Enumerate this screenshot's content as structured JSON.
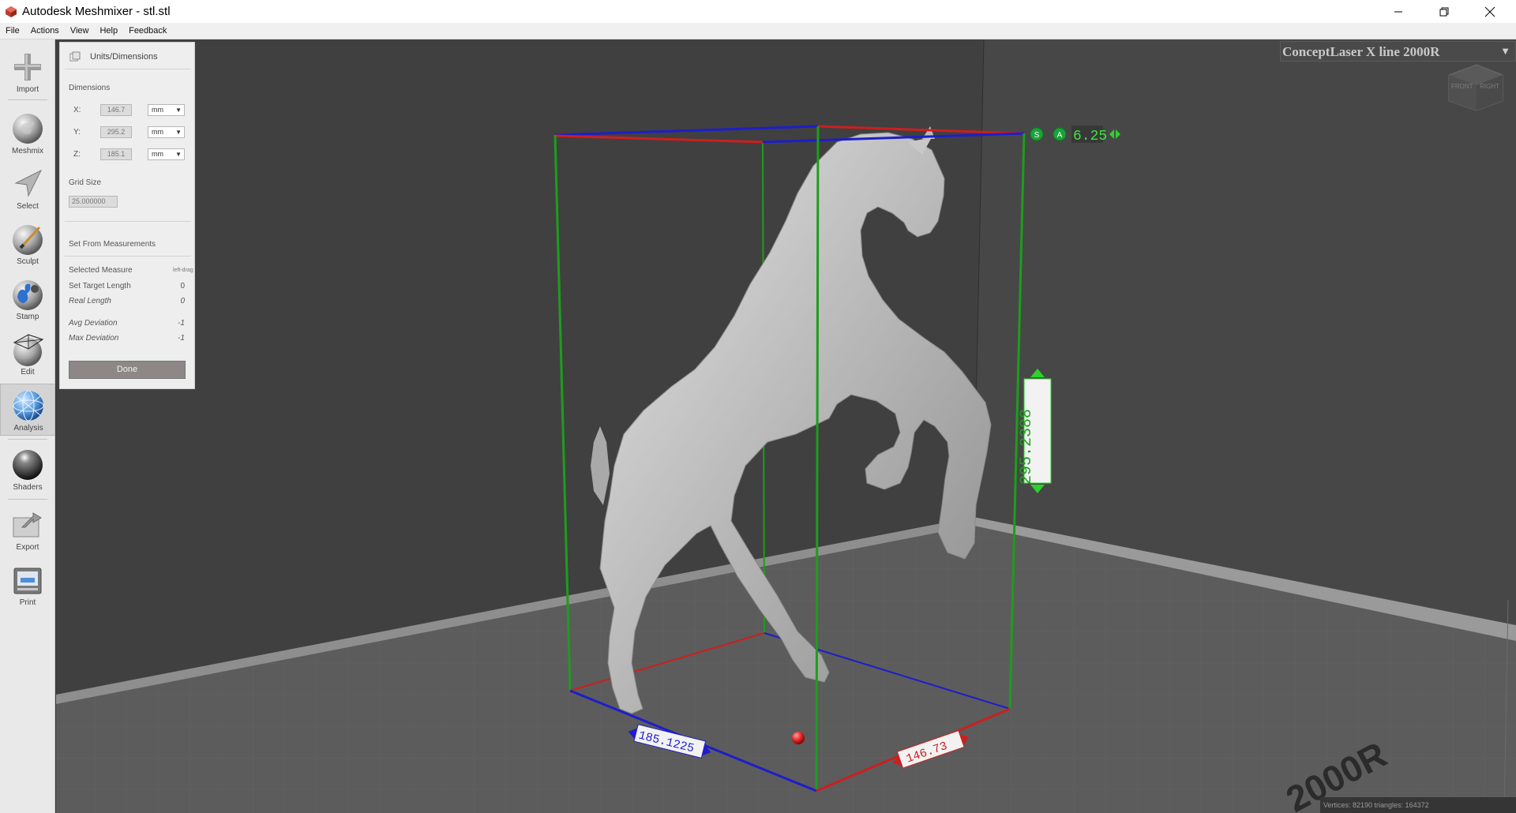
{
  "window": {
    "title": "Autodesk Meshmixer - stl.stl"
  },
  "menu": {
    "items": [
      "File",
      "Actions",
      "View",
      "Help",
      "Feedback"
    ]
  },
  "toolbar": {
    "tools": [
      {
        "label": "Import",
        "icon": "plus-icon"
      },
      {
        "label": "Meshmix",
        "icon": "bunny-sphere-icon"
      },
      {
        "label": "Select",
        "icon": "arrow-cursor-icon"
      },
      {
        "label": "Sculpt",
        "icon": "brush-sphere-icon"
      },
      {
        "label": "Stamp",
        "icon": "stamp-sphere-icon"
      },
      {
        "label": "Edit",
        "icon": "edit-sphere-icon"
      },
      {
        "label": "Analysis",
        "icon": "analysis-sphere-icon"
      },
      {
        "label": "Shaders",
        "icon": "shader-sphere-icon"
      },
      {
        "label": "Export",
        "icon": "export-folder-icon"
      },
      {
        "label": "Print",
        "icon": "printer-icon"
      }
    ],
    "active": "Analysis"
  },
  "panel": {
    "title": "Units/Dimensions",
    "dimensions_label": "Dimensions",
    "x_label": "X:",
    "x_value": "146.7",
    "x_unit": "mm",
    "y_label": "Y:",
    "y_value": "295.2",
    "y_unit": "mm",
    "z_label": "Z:",
    "z_value": "185.1",
    "z_unit": "mm",
    "grid_size_label": "Grid Size",
    "grid_size_value": "25.000000",
    "set_from_label": "Set From Measurements",
    "selected_measure_label": "Selected Measure",
    "selected_measure_value": "left-drag",
    "set_target_length_label": "Set Target Length",
    "set_target_length_value": "0",
    "real_length_label": "Real Length",
    "real_length_value": "0",
    "avg_deviation_label": "Avg Deviation",
    "avg_deviation_value": "-1",
    "max_deviation_label": "Max Deviation",
    "max_deviation_value": "-1",
    "done_label": "Done"
  },
  "viewport": {
    "printer": "ConceptLaser X line 2000R",
    "view_cube": {
      "front": "FRONT",
      "right": "RIGHT"
    },
    "scale_value": "6.25",
    "dim_height": "295.2388",
    "dim_depth": "185.1225",
    "dim_width": "146.73",
    "floor_text": "2000R",
    "status": "Vertices: 82190  triangles: 164372",
    "colors": {
      "x_axis": "#cc1f1f",
      "y_axis": "#1d9d1d",
      "z_axis": "#1d1dcc",
      "accent": "#2bd32b"
    }
  }
}
